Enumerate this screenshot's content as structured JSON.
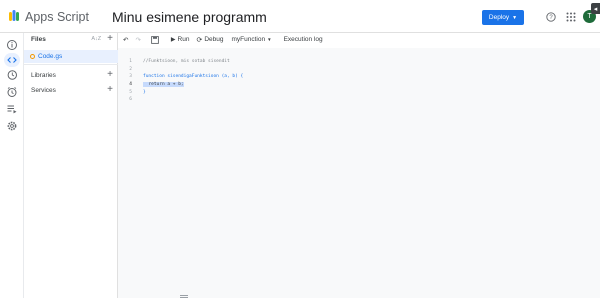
{
  "header": {
    "app_name": "Apps Script",
    "project_title": "Minu esimene programm",
    "deploy_label": "Deploy",
    "avatar_initial": "T",
    "brand_color": "#1a73e8"
  },
  "files_panel": {
    "files_label": "Files",
    "libraries_label": "Libraries",
    "services_label": "Services",
    "files": [
      {
        "name": "Code.gs"
      }
    ]
  },
  "toolbar": {
    "run_label": "Run",
    "debug_label": "Debug",
    "function_select": "myFunction",
    "execution_log_label": "Execution log"
  },
  "editor": {
    "line_numbers": [
      "1",
      "2",
      "3",
      "4",
      "5",
      "6"
    ],
    "lines": [
      "//Funktsioon, mis sotab sisendit",
      "",
      "function sisendigaFunktsioon (a, b) {",
      "  return a + b;",
      "}",
      ""
    ]
  },
  "icons": {
    "rail": [
      "info-icon",
      "code-icon",
      "history-icon",
      "triggers-icon",
      "executions-icon",
      "settings-icon"
    ]
  }
}
